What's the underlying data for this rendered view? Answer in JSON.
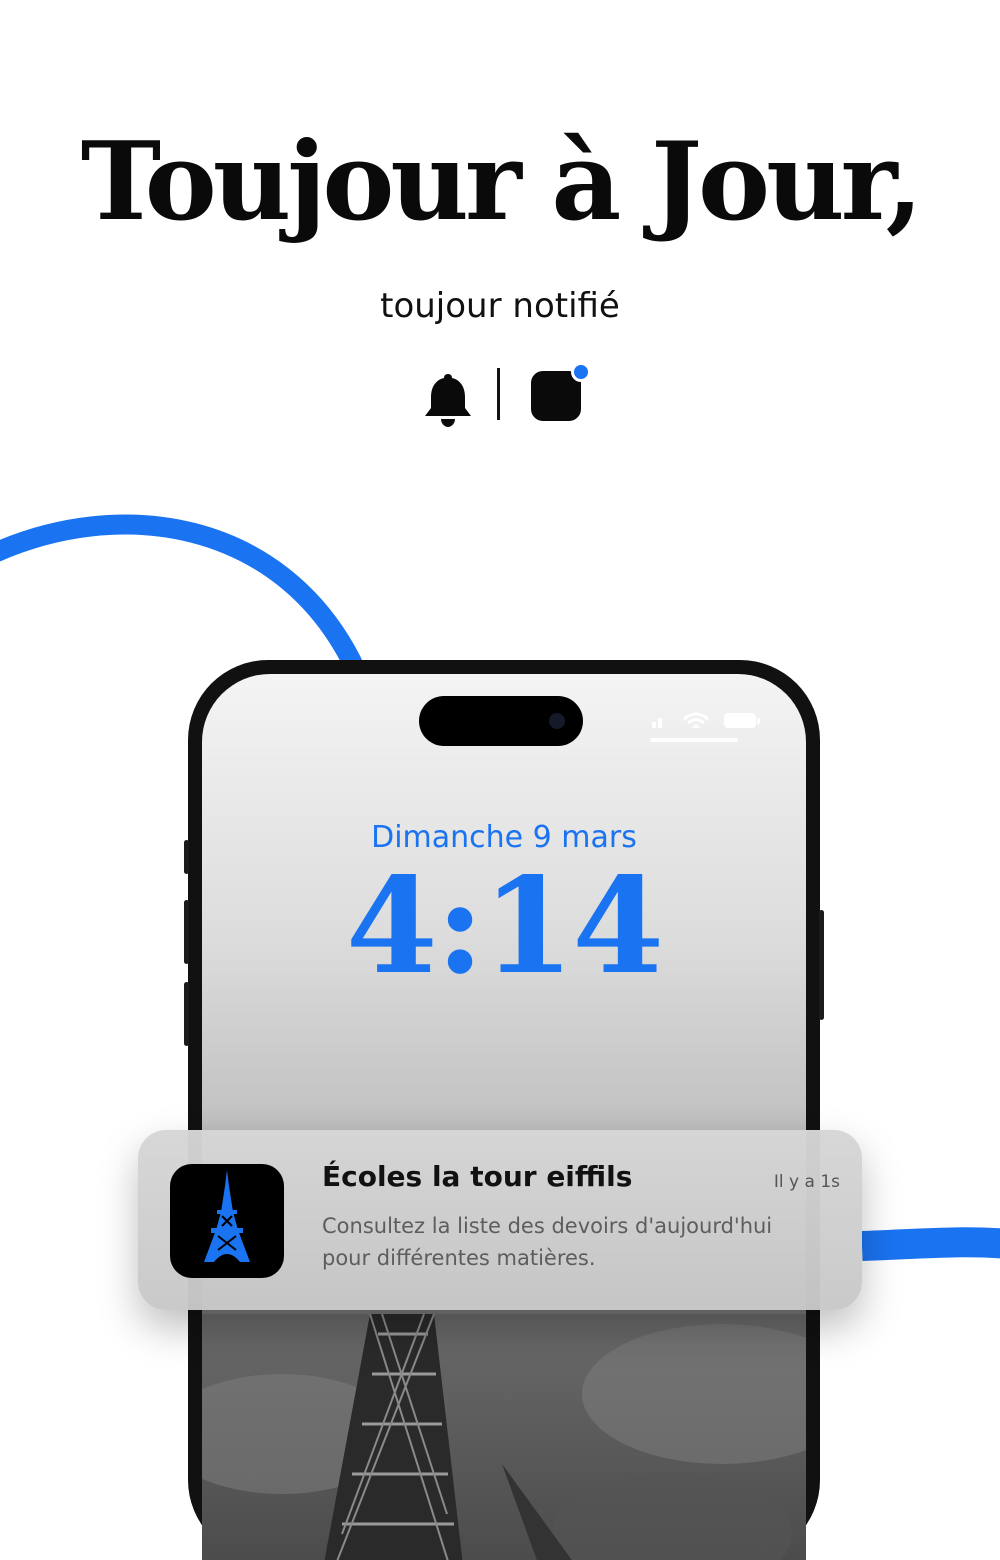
{
  "headline": "Toujour à Jour,",
  "subtitle": "toujour notifié",
  "icons": {
    "bell": "bell-icon",
    "app": "app-square-icon",
    "badge_color": "#1a73f0"
  },
  "accent_color": "#1a73f0",
  "lockscreen": {
    "date": "Dimanche 9 mars",
    "time": "4:14"
  },
  "notification": {
    "app_icon": "eiffel-tower-icon",
    "title": "Écoles la tour eiffils",
    "timestamp": "Il y a 1s",
    "body": "Consultez la liste des devoirs d'aujourd'hui pour différentes matières."
  }
}
